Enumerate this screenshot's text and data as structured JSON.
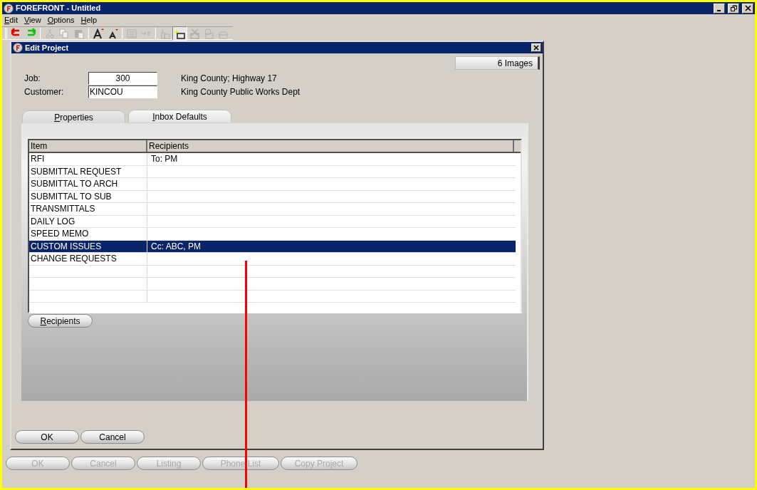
{
  "window": {
    "title": "FOREFRONT - Untitled"
  },
  "menu": [
    {
      "label": "Edit"
    },
    {
      "label": "View"
    },
    {
      "label": "Options"
    },
    {
      "label": "Help"
    }
  ],
  "toolbar": [
    {
      "kind": "undo",
      "disabled": false
    },
    {
      "kind": "redo",
      "disabled": false
    },
    {
      "kind": "sep"
    },
    {
      "kind": "cut",
      "disabled": true
    },
    {
      "kind": "copy",
      "disabled": true
    },
    {
      "kind": "paste",
      "disabled": true
    },
    {
      "kind": "sep"
    },
    {
      "kind": "font-up",
      "disabled": false
    },
    {
      "kind": "font-down",
      "disabled": false
    },
    {
      "kind": "sep"
    },
    {
      "kind": "list",
      "disabled": true
    },
    {
      "kind": "indent",
      "disabled": true
    },
    {
      "kind": "sep"
    },
    {
      "kind": "tray",
      "disabled": true
    },
    {
      "kind": "tray-new",
      "disabled": false
    },
    {
      "kind": "tray-x",
      "disabled": true
    },
    {
      "kind": "tray-grid",
      "disabled": true
    },
    {
      "kind": "tray-plain",
      "disabled": true
    }
  ],
  "dialog": {
    "title": "Edit Project",
    "images_button": "6 Images",
    "fields": [
      {
        "label": "Job:",
        "value": "300",
        "kind": "numeric",
        "description": "King County; Highway 17"
      },
      {
        "label": "Customer:",
        "value": "KINCOU",
        "kind": "code",
        "description": "King County Public Works Dept"
      }
    ],
    "tabs": [
      {
        "label": "Properties",
        "selected": false
      },
      {
        "label": "Inbox Defaults",
        "selected": true
      }
    ],
    "table": {
      "columns": [
        "Item",
        "Recipients"
      ],
      "rows": [
        {
          "item": "RFI",
          "recipients": "To: PM",
          "selected": false
        },
        {
          "item": "SUBMITTAL REQUEST",
          "selected": false
        },
        {
          "item": "SUBMITTAL TO ARCH",
          "selected": false
        },
        {
          "item": "SUBMITTAL TO SUB",
          "selected": false
        },
        {
          "item": "TRANSMITTALS",
          "selected": false
        },
        {
          "item": "DAILY LOG",
          "selected": false
        },
        {
          "item": "SPEED MEMO",
          "selected": false
        },
        {
          "item": "CUSTOM ISSUES",
          "recipients": "Cc: ABC, PM",
          "selected": true
        },
        {
          "item": "CHANGE REQUESTS",
          "selected": false
        }
      ]
    },
    "recipients_button": "Recipients",
    "buttons": [
      {
        "label": "OK"
      },
      {
        "label": "Cancel"
      }
    ]
  },
  "bottom_buttons": [
    {
      "label": "OK",
      "disabled": true
    },
    {
      "label": "Cancel",
      "disabled": true
    },
    {
      "label": "Listing",
      "disabled": true
    },
    {
      "label": "Phone List",
      "disabled": true
    },
    {
      "label": "Copy Project",
      "disabled": true
    }
  ]
}
